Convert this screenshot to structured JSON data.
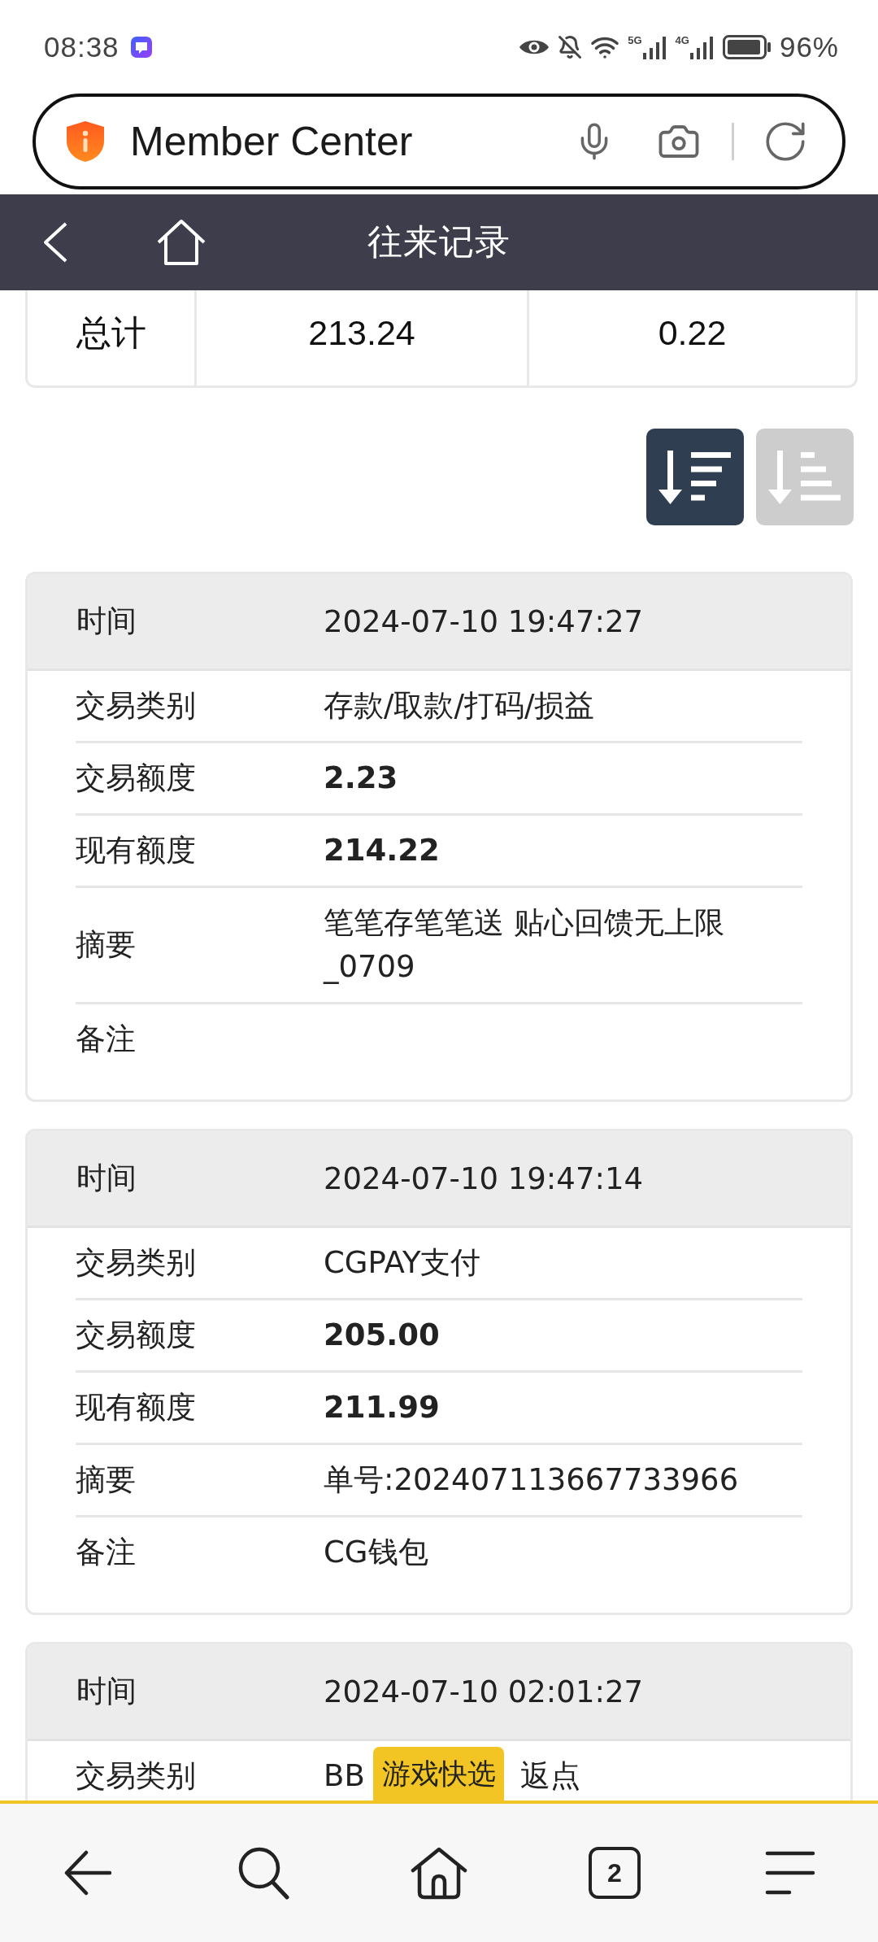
{
  "status_bar": {
    "time": "08:38",
    "networks": [
      {
        "label": "5G"
      },
      {
        "label": "4G"
      }
    ],
    "battery": "96%"
  },
  "address_bar": {
    "title": "Member Center"
  },
  "header": {
    "title": "往来记录"
  },
  "totals": {
    "cells": [
      "总计",
      "213.24",
      "0.22"
    ]
  },
  "sort_buttons": [
    {
      "kind": "descending",
      "selected": true
    },
    {
      "kind": "ascending",
      "selected": false
    }
  ],
  "records": [
    {
      "time_label": "时间",
      "time": "2024-07-10 19:47:27",
      "fields": [
        {
          "label": "交易类别",
          "kind": "text",
          "value": "存款/取款/打码/损益"
        },
        {
          "label": "交易额度",
          "kind": "amount",
          "value": "2.23"
        },
        {
          "label": "现有额度",
          "kind": "amount",
          "value": "214.22"
        },
        {
          "label": "摘要",
          "kind": "text",
          "value": "笔笔存笔笔送 贴心回馈无上限_0709"
        },
        {
          "label": "备注"
        }
      ]
    },
    {
      "time_label": "时间",
      "time": "2024-07-10 19:47:14",
      "fields": [
        {
          "label": "交易类别",
          "kind": "text",
          "value": "CGPAY支付"
        },
        {
          "label": "交易额度",
          "kind": "amount",
          "value": "205.00"
        },
        {
          "label": "现有额度",
          "kind": "amount",
          "value": "211.99"
        },
        {
          "label": "摘要",
          "kind": "text",
          "value": "单号:202407113667733966"
        },
        {
          "label": "备注",
          "kind": "text",
          "value": "CG钱包"
        }
      ]
    },
    {
      "time_label": "时间",
      "time": "2024-07-10 02:01:27",
      "fields": [
        {
          "label": "交易类别",
          "kind": "text",
          "value": "BB",
          "value_tail": "返点"
        }
      ]
    }
  ],
  "floating_tab": {
    "label": "游戏快选"
  },
  "bottom_nav": {
    "tab_count": "2"
  }
}
